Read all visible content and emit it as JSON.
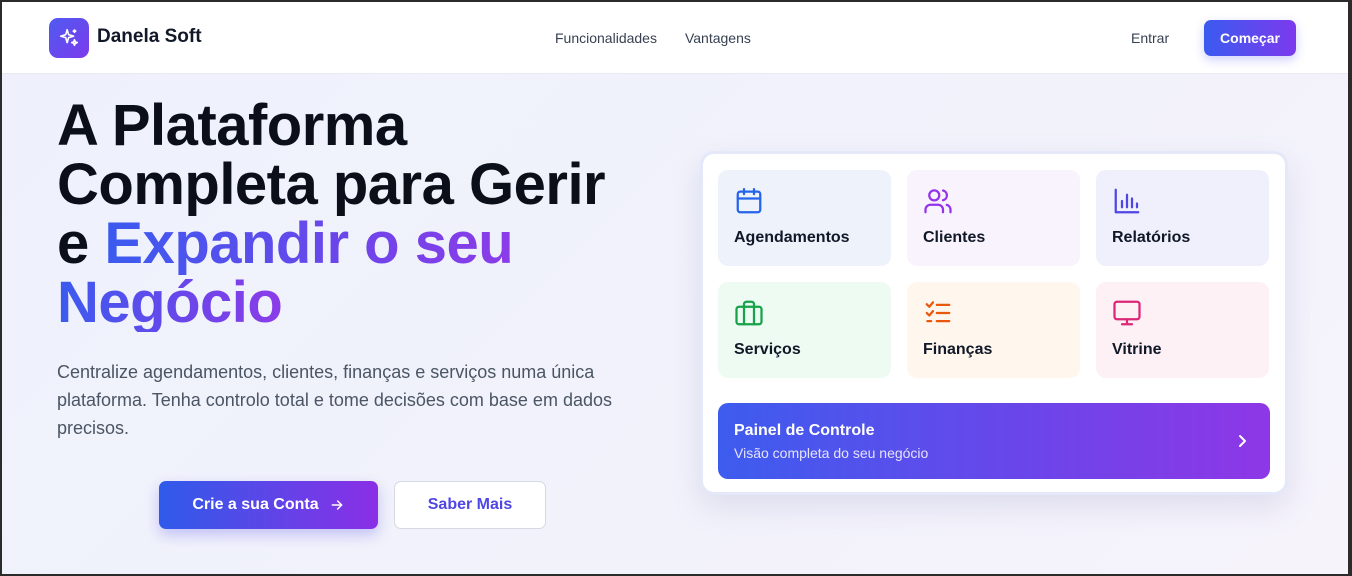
{
  "nav": {
    "brand": "Danela Soft",
    "links": [
      "Funcionalidades",
      "Vantagens"
    ],
    "login": "Entrar",
    "start": "Começar"
  },
  "hero": {
    "title_line1": "A Plataforma",
    "title_line2": "Completa para Gerir",
    "title_e": "e ",
    "title_grad1": "Expandir o seu",
    "title_grad2": "Negócio",
    "subtitle": "Centralize agendamentos, clientes, finanças e serviços numa única plataforma. Tenha controlo total e tome decisões com base em dados precisos.",
    "cta_primary": "Crie a sua Conta",
    "cta_secondary": "Saber Mais"
  },
  "card": {
    "tiles": [
      {
        "label": "Agendamentos",
        "icon": "calendar-icon",
        "color": "#2563eb",
        "bg": "#eef2fb"
      },
      {
        "label": "Clientes",
        "icon": "users-icon",
        "color": "#9333ea",
        "bg": "#f9f3fd"
      },
      {
        "label": "Relatórios",
        "icon": "bar-chart-icon",
        "color": "#4f46e5",
        "bg": "#eff0fb"
      },
      {
        "label": "Serviços",
        "icon": "briefcase-icon",
        "color": "#16a34a",
        "bg": "#eefbf3"
      },
      {
        "label": "Finanças",
        "icon": "list-check-icon",
        "color": "#ea580c",
        "bg": "#fff6ee"
      },
      {
        "label": "Vitrine",
        "icon": "monitor-icon",
        "color": "#db2777",
        "bg": "#fdf1f6"
      }
    ],
    "panel": {
      "title": "Painel de Controle",
      "subtitle": "Visão completa do seu negócio"
    }
  }
}
